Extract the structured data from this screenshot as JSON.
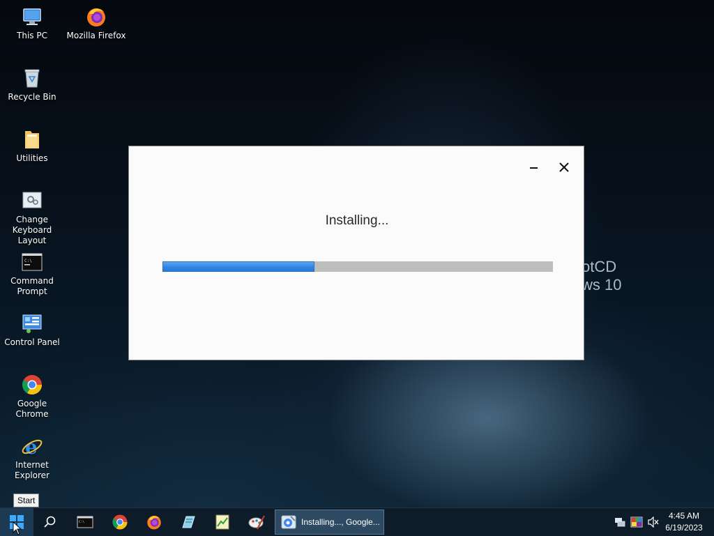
{
  "desktop": {
    "icons": [
      {
        "label": "This PC"
      },
      {
        "label": "Mozilla Firefox"
      },
      {
        "label": "Recycle Bin"
      },
      {
        "label": "Utilities"
      },
      {
        "label": "Change Keyboard Layout"
      },
      {
        "label": "Command Prompt"
      },
      {
        "label": "Control Panel"
      },
      {
        "label": "Google Chrome"
      },
      {
        "label": "Internet Explorer"
      }
    ],
    "watermark": {
      "line1": "otCD",
      "line2": "ws 10"
    }
  },
  "installer": {
    "status_text": "Installing...",
    "progress_fraction": 0.39,
    "minimize_icon": "minimize-icon",
    "close_icon": "close-icon"
  },
  "taskbar": {
    "start_tooltip": "Start",
    "pinned": [
      {
        "name": "search-icon"
      },
      {
        "name": "command-prompt-icon"
      },
      {
        "name": "chrome-icon"
      },
      {
        "name": "firefox-icon"
      },
      {
        "name": "edit-pad-icon"
      },
      {
        "name": "notepad-chart-icon"
      },
      {
        "name": "paint-icon"
      }
    ],
    "active_task": {
      "label": "Installing..., Google..."
    },
    "tray": {
      "icons": [
        "network-icon",
        "color-palette-icon",
        "volume-muted-icon"
      ],
      "time": "4:45 AM",
      "date": "6/19/2023"
    }
  },
  "colors": {
    "progress_fill": "#3187e6",
    "progress_track": "#bdbdbd",
    "taskbar_bg": "#0e1c2a",
    "window_bg": "#fbfbfb"
  }
}
